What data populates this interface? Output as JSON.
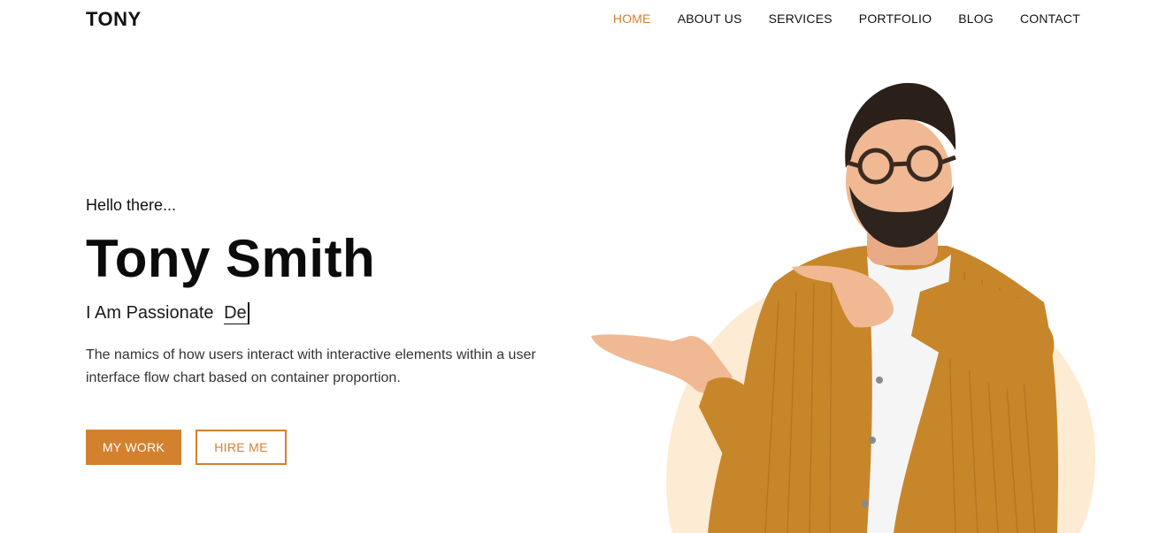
{
  "brand": {
    "logo": "TONY"
  },
  "nav": {
    "items": [
      {
        "label": "HOME",
        "active": true
      },
      {
        "label": "ABOUT US",
        "active": false
      },
      {
        "label": "SERVICES",
        "active": false
      },
      {
        "label": "PORTFOLIO",
        "active": false
      },
      {
        "label": "BLOG",
        "active": false
      },
      {
        "label": "CONTACT",
        "active": false
      }
    ]
  },
  "hero": {
    "greeting": "Hello there...",
    "name": "Tony Smith",
    "tagline_prefix": "I Am Passionate",
    "tagline_typed": "De",
    "description": "The namics of how users interact with interactive elements within a user interface flow chart based on container proportion.",
    "primary_button": "MY WORK",
    "secondary_button": "HIRE ME",
    "image_alt": "portrait-photo"
  },
  "colors": {
    "accent": "#d4812e",
    "text": "#111111",
    "blob": "#fdebd3",
    "jacket": "#c8862a"
  }
}
